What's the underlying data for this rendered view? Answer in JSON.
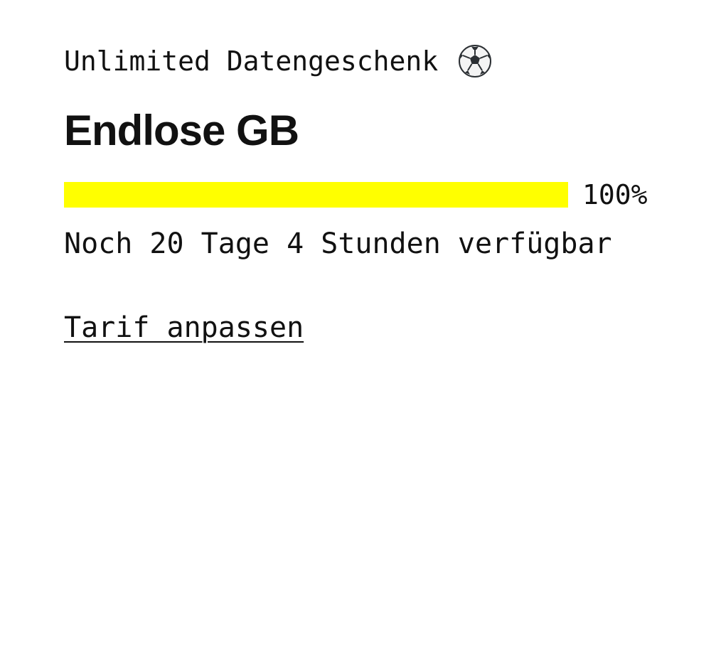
{
  "offer": {
    "eyebrow": "Unlimited Datengeschenk",
    "eyebrow_icon": "soccer-ball-icon",
    "title": "Endlose GB",
    "progress": {
      "percent": 100,
      "label": "100%",
      "fill_color": "#ffff00"
    },
    "remaining_text": "Noch 20 Tage 4 Stunden verfügbar",
    "action_link": "Tarif anpassen"
  }
}
